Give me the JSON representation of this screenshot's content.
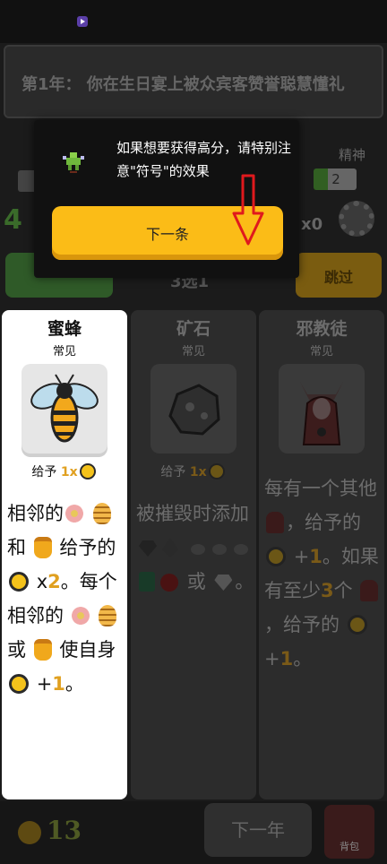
{
  "banner": {
    "text": "第1年：  你在生日宴上被众宾客赞誉聪慧懂礼"
  },
  "stats": {
    "spirit_label": "精神",
    "spirit_value": "2",
    "left_value": "4",
    "multiplier": "x0",
    "skip_label": "跳过",
    "spin_label": "3选1"
  },
  "tip": {
    "text": "如果想要获得高分，请特别注意\"符号\"的效果",
    "next_label": "下一条",
    "accent": "#fbbc17"
  },
  "cards": [
    {
      "name": "蜜蜂",
      "rarity": "常见",
      "give_prefix": "给予",
      "give_mult": "1x",
      "desc": {
        "t1": "相邻的",
        "t2": "和",
        "t3": "给予的",
        "t4": "x",
        "t5": "2",
        "t6": "。每个相邻的",
        "t7": "或",
        "t8": "使自身",
        "t9": "+",
        "t10": "1",
        "t11": "。"
      }
    },
    {
      "name": "矿石",
      "rarity": "常见",
      "give_prefix": "给予",
      "give_mult": "1x",
      "desc": {
        "t1": "被摧毁时添加",
        "t2": "或",
        "t3": "。"
      }
    },
    {
      "name": "邪教徒",
      "rarity": "常见",
      "desc": {
        "t1": "每有一个其他",
        "t2": "，给予的",
        "t3": "+",
        "t4": "1",
        "t5": "。如果有至少",
        "t6": "3",
        "t7": "个",
        "t8": "，给予的",
        "t9": "+",
        "t10": "1",
        "t11": "。"
      }
    }
  ],
  "bottom": {
    "coins": "13",
    "next_year_label": "下一年",
    "backpack_label": "背包"
  },
  "colors": {
    "highlight": "#e0a020",
    "coin": "#f4c21b",
    "annotation_arrow": "#e0191d"
  }
}
